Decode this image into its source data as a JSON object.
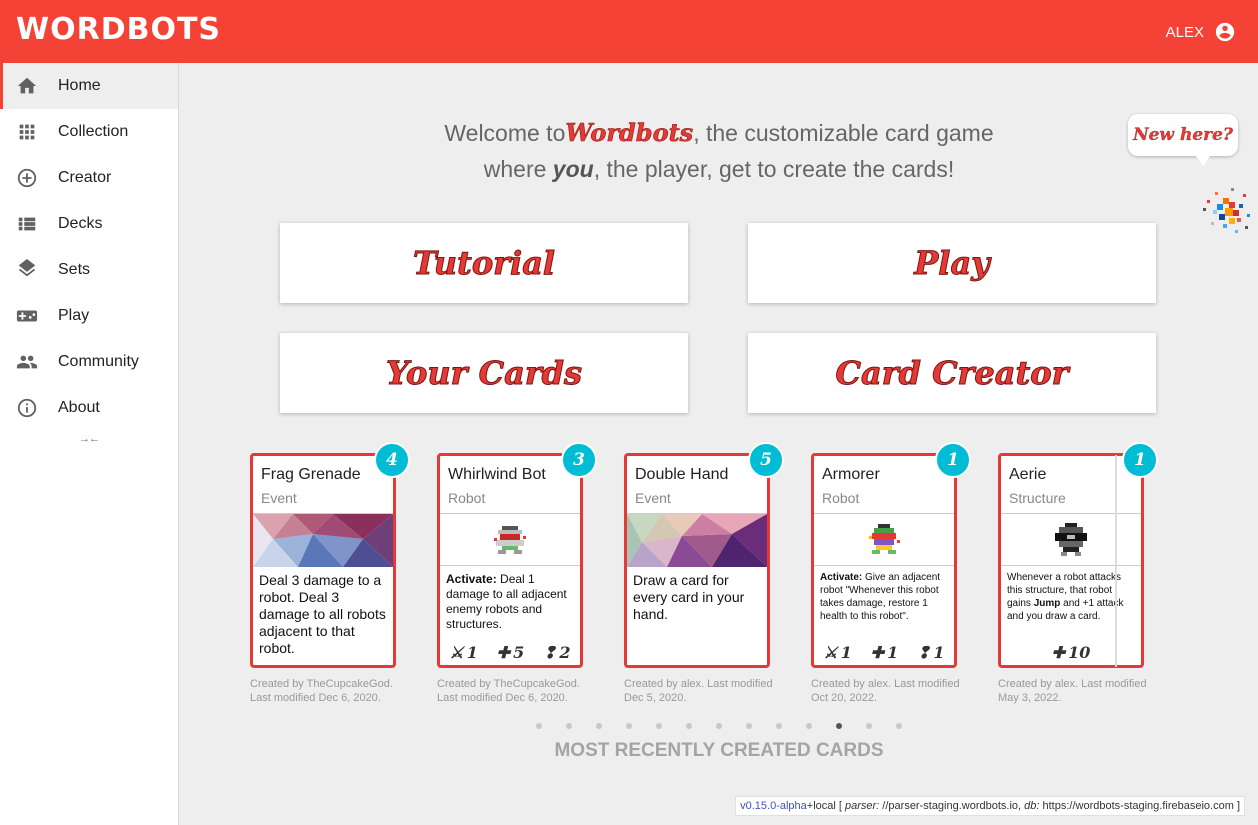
{
  "app": {
    "logo": "WORDBOTS",
    "user_name": "ALEX"
  },
  "sidebar": {
    "items": [
      {
        "label": "Home",
        "icon": "home-icon"
      },
      {
        "label": "Collection",
        "icon": "grid-icon"
      },
      {
        "label": "Creator",
        "icon": "add-circle-icon"
      },
      {
        "label": "Decks",
        "icon": "list-icon"
      },
      {
        "label": "Sets",
        "icon": "layers-icon"
      },
      {
        "label": "Play",
        "icon": "gamepad-icon"
      },
      {
        "label": "Community",
        "icon": "people-icon"
      },
      {
        "label": "About",
        "icon": "info-icon"
      }
    ],
    "collapse_label": "→←"
  },
  "welcome": {
    "prefix": "Welcome to",
    "brand": "Wordbots",
    "suffix": ", the customizable card game",
    "line2_a": "where ",
    "line2_em": "you",
    "line2_b": ", the player, get to create the cards!"
  },
  "help_bubble": "New here?",
  "buttons": {
    "tutorial": "Tutorial",
    "play": "Play",
    "your_cards": "Your Cards",
    "card_creator": "Card Creator"
  },
  "cards": [
    {
      "name": "Frag Grenade",
      "type": "Event",
      "cost": "4",
      "text": "Deal 3 damage to a robot. Deal 3 damage to all robots adjacent to that robot.",
      "stats": [],
      "meta": "Created by TheCupcakeGod. Last modified Dec 6, 2020."
    },
    {
      "name": "Whirlwind Bot",
      "type": "Robot",
      "cost": "3",
      "text_bold": "Activate:",
      "text": " Deal 1 damage to all adjacent enemy robots and structures.",
      "stats": {
        "attack": "1",
        "health": "5",
        "speed": "2"
      },
      "meta": "Created by TheCupcakeGod. Last modified Dec 6, 2020."
    },
    {
      "name": "Double Hand",
      "type": "Event",
      "cost": "5",
      "text": "Draw a card for every card in your hand.",
      "stats": [],
      "meta": "Created by alex. Last modified Dec 5, 2020."
    },
    {
      "name": "Armorer",
      "type": "Robot",
      "cost": "1",
      "text_bold": "Activate:",
      "text": " Give an adjacent robot \"Whenever this robot takes damage, restore 1 health to this robot\".",
      "stats": {
        "attack": "1",
        "health": "1",
        "speed": "1"
      },
      "meta": "Created by alex. Last modified Oct 20, 2022."
    },
    {
      "name": "Aerie",
      "type": "Structure",
      "cost": "1",
      "text_a": "Whenever a robot attacks this structure, that robot gains ",
      "text_bold": "Jump",
      "text_b": " and +1 attack and you draw a card.",
      "stats": {
        "health": "10"
      },
      "meta": "Created by alex. Last modified May 3, 2022."
    }
  ],
  "carousel": {
    "dot_count": 13,
    "active_index": 10,
    "heading": "MOST RECENTLY CREATED CARDS"
  },
  "version": {
    "version": "v0.15.0-alpha",
    "build": "+local [ ",
    "parser_label": "parser:",
    "parser_url": " //parser-staging.wordbots.io, ",
    "db_label": "db:",
    "db_url": " https://wordbots-staging.firebaseio.com ]"
  },
  "colors": {
    "primary": "#f44336",
    "card_border": "#e53935",
    "cost_badge": "#00bcd4"
  }
}
